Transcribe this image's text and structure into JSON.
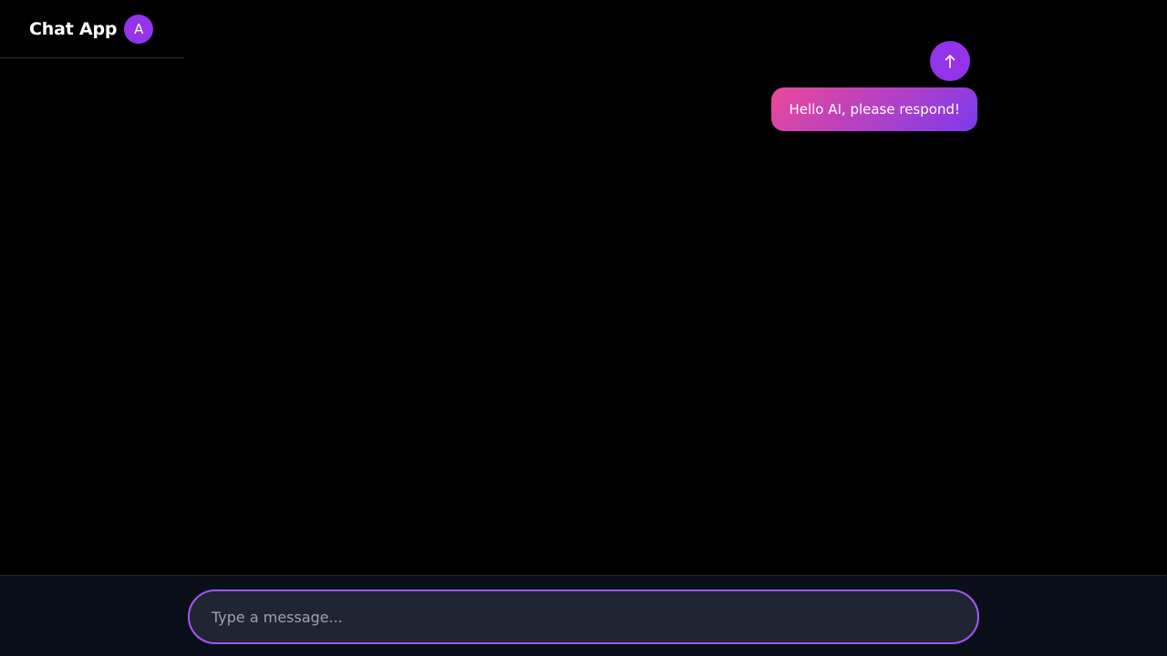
{
  "header": {
    "title": "Chat App",
    "avatar_initial": "A"
  },
  "messages": [
    {
      "role": "user",
      "text": "Hello AI, please respond!"
    }
  ],
  "composer": {
    "placeholder": "Type a message...",
    "value": "",
    "send_icon": "arrow-up-icon"
  },
  "colors": {
    "background": "#000000",
    "accent": "#9333ea",
    "input_border": "#a855f7",
    "bubble_gradient_start": "#ec4899",
    "bubble_gradient_end": "#7c3aed",
    "composer_background": "#0b0f1a",
    "input_background": "#1f2533"
  }
}
